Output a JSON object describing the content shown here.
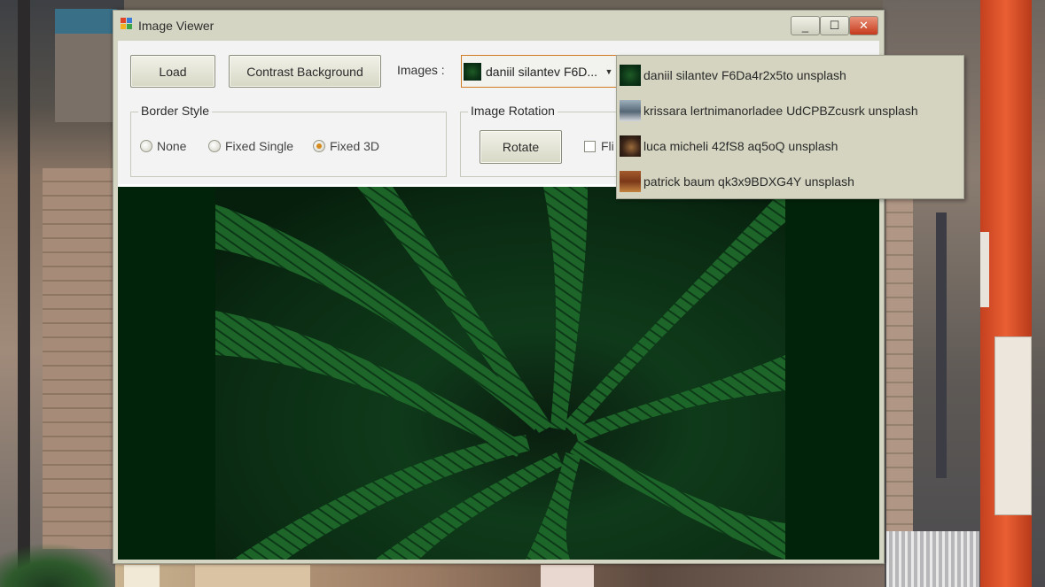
{
  "window": {
    "title": "Image Viewer",
    "controls": {
      "minimize": "_",
      "maximize": "☐",
      "close": "✕"
    }
  },
  "toolbar": {
    "load_label": "Load",
    "contrast_label": "Contrast Background",
    "images_label": "Images :",
    "images_selected": "daniil silantev F6D..."
  },
  "border_style": {
    "title": "Border Style",
    "options": [
      {
        "label": "None",
        "selected": false
      },
      {
        "label": "Fixed Single",
        "selected": false
      },
      {
        "label": "Fixed 3D",
        "selected": true
      }
    ]
  },
  "image_rotation": {
    "title": "Image Rotation",
    "rotate_label": "Rotate",
    "flip_label": "Fli",
    "flip_checked": false
  },
  "dropdown": {
    "items": [
      {
        "label": "daniil silantev F6Da4r2x5to unsplash",
        "icon": "fern-thumbnail"
      },
      {
        "label": "krissara lertnimanorladee UdCPBZcusrk unsplash",
        "icon": "krissara-thumbnail"
      },
      {
        "label": "luca micheli 42fS8 aq5oQ unsplash",
        "icon": "luca-thumbnail"
      },
      {
        "label": "patrick baum qk3x9BDXG4Y unsplash",
        "icon": "patrick-thumbnail"
      }
    ]
  },
  "colors": {
    "accent": "#d07b23",
    "image_background": "#00230a",
    "dropdown_background": "#d4d4c0"
  }
}
